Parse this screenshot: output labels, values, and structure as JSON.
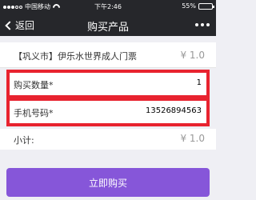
{
  "status_bar": {
    "carrier": "中国移动",
    "time": "下午2:46",
    "battery": "55%",
    "battery_level": 0.55
  },
  "nav": {
    "back_label": "返回",
    "title": "购买产品"
  },
  "product": {
    "name": "【巩义市】伊乐水世界成人门票",
    "price": "¥ 1.0"
  },
  "quantity": {
    "label": "购买数量*",
    "value": "1"
  },
  "phone": {
    "label": "手机号码*",
    "value": "13526894563"
  },
  "subtotal": {
    "label": "小计:",
    "value": "¥ 1.0"
  },
  "buy_button": "立即购买",
  "colors": {
    "nav_bg": "#26272b",
    "highlight_border": "#e8232f",
    "buy_button": "#8656d9"
  }
}
